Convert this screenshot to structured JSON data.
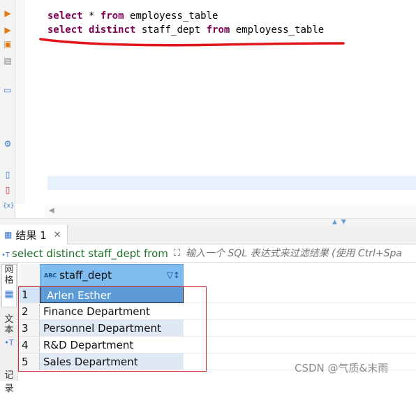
{
  "editor": {
    "lines": [
      {
        "parts": [
          {
            "t": "select",
            "kw": true
          },
          {
            "t": " * "
          },
          {
            "t": "from",
            "kw": true
          },
          {
            "t": " employess_table"
          }
        ]
      },
      {
        "parts": [
          {
            "t": "select",
            "kw": true
          },
          {
            "t": " "
          },
          {
            "t": "distinct",
            "kw": true
          },
          {
            "t": " staff_dept "
          },
          {
            "t": "from",
            "kw": true
          },
          {
            "t": " employess_table"
          }
        ]
      }
    ],
    "gutter_icons": [
      "run-statement-icon",
      "run-script-icon",
      "explain-plan-icon",
      "load-plan-icon",
      "console-icon",
      "settings-icon",
      "export-icon",
      "new-script-icon",
      "variables-icon"
    ]
  },
  "result": {
    "tab_label": "结果 1",
    "tab_close": "✕",
    "query_preview": "select distinct staff_dept from",
    "query_tag": "•T",
    "filter_placeholder": "输入一个 SQL 表达式来过滤结果 (使用 Ctrl+Spa",
    "side_tabs": {
      "grid": "网格",
      "text": "文本",
      "record": "记录"
    },
    "column": {
      "type": "ABC",
      "name": "staff_dept"
    },
    "rows": [
      {
        "num": "1",
        "value": "Arlen Esther"
      },
      {
        "num": "2",
        "value": "Finance Department"
      },
      {
        "num": "3",
        "value": "Personnel Department"
      },
      {
        "num": "4",
        "value": "R&D Department"
      },
      {
        "num": "5",
        "value": "Sales Department"
      }
    ]
  },
  "watermark": "CSDN @气质&末雨",
  "colors": {
    "keyword": "#7f0055",
    "header": "#7fbdf0",
    "selected": "#5c9ad8",
    "annotation": "#d9252b"
  }
}
